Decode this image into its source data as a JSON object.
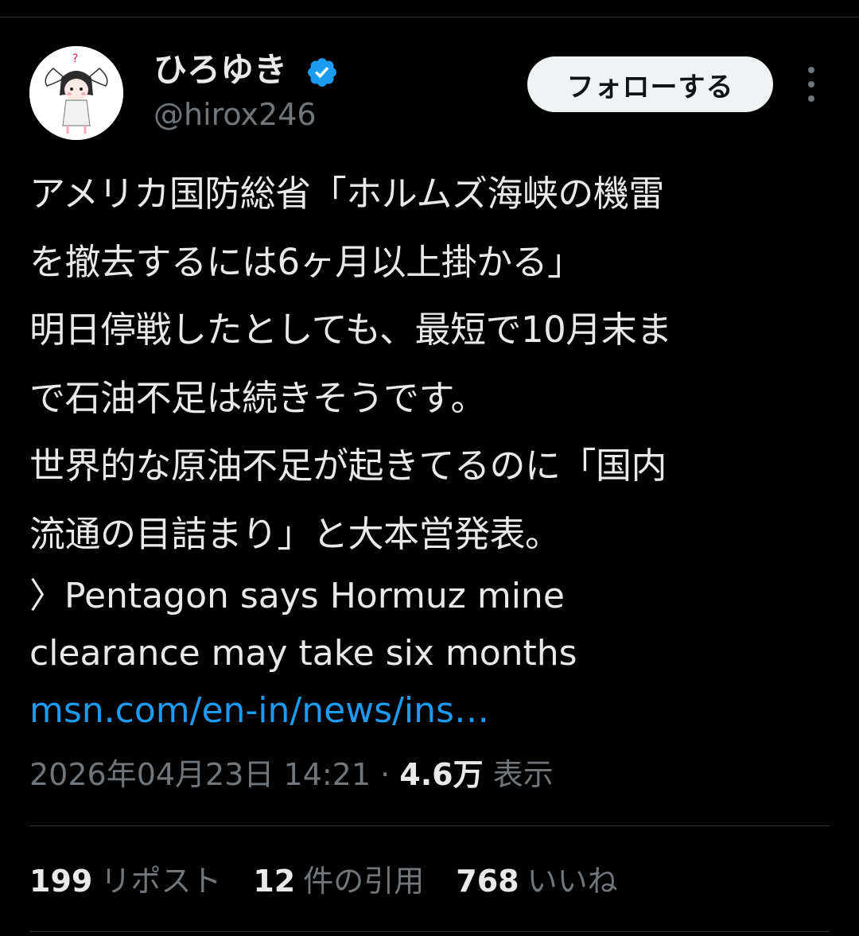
{
  "user": {
    "display_name": "ひろゆき",
    "handle": "@hirox246",
    "verified_icon": "verified-badge-icon"
  },
  "header": {
    "follow_label": "フォローする",
    "more_icon": "more-vertical-icon"
  },
  "tweet": {
    "lines_jp": [
      "アメリカ国防総省「ホルムズ海峡の機雷",
      "を撤去するには6ヶ月以上掛かる」",
      "明日停戦したとしても、最短で10月末ま",
      "で石油不足は続きそうです。",
      "世界的な原油不足が起きてるのに「国内",
      "流通の目詰まり」と大本営発表。"
    ],
    "lines_en": [
      "〉Pentagon says Hormuz mine",
      "clearance may take six months"
    ],
    "link": "msn.com/en-in/news/ins…"
  },
  "meta": {
    "timestamp": "2026年04月23日 14:21",
    "separator": "·",
    "views_count": "4.6万",
    "views_label": "表示"
  },
  "stats": {
    "reposts_count": "199",
    "reposts_label": "リポスト",
    "quotes_count": "12",
    "quotes_label": "件の引用",
    "likes_count": "768",
    "likes_label": "いいね"
  },
  "colors": {
    "background": "#000000",
    "text": "#e7e9ea",
    "secondary": "#71767b",
    "link": "#1d9bf0",
    "verified": "#1d9bf0"
  }
}
